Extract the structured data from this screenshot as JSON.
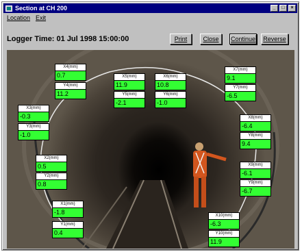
{
  "window": {
    "title": "Section at CH 200",
    "controls": [
      "_",
      "□",
      "×"
    ]
  },
  "menu": {
    "items": [
      "Location",
      "Exit"
    ]
  },
  "logger": {
    "label": "Logger Time: 01 Jul 1998 15:00:00"
  },
  "toolbar": {
    "print": "Print",
    "close": "Close",
    "continue": "Continue",
    "reverse": "Reverse"
  },
  "meters": [
    {
      "label": "X4(mm)",
      "value": "0.7"
    },
    {
      "label": "Y4(mm)",
      "value": "11.2"
    },
    {
      "label": "X5(mm)",
      "value": "11.9"
    },
    {
      "label": "Y5(mm)",
      "value": "-2.1"
    },
    {
      "label": "X6(mm)",
      "value": "10.8"
    },
    {
      "label": "Y6(mm)",
      "value": "-1.0"
    },
    {
      "label": "X7(mm)",
      "value": "9.1"
    },
    {
      "label": "Y7(mm)",
      "value": "-6.5"
    },
    {
      "label": "X3(mm)",
      "value": "-0.3"
    },
    {
      "label": "Y3(mm)",
      "value": "-1.0"
    },
    {
      "label": "X8(mm)",
      "value": "-6.4"
    },
    {
      "label": "Y8(mm)",
      "value": "9.4"
    },
    {
      "label": "X2(mm)",
      "value": "0.5"
    },
    {
      "label": "Y2(mm)",
      "value": "0.8"
    },
    {
      "label": "X9(mm)",
      "value": "-6.1"
    },
    {
      "label": "Y9(mm)",
      "value": "-6.7"
    },
    {
      "label": "X1(mm)",
      "value": "-1.8"
    },
    {
      "label": "Y1(mm)",
      "value": "0.4"
    },
    {
      "label": "X10(mm)",
      "value": "-6.3"
    },
    {
      "label": "Y10(mm)",
      "value": "11.9"
    }
  ]
}
